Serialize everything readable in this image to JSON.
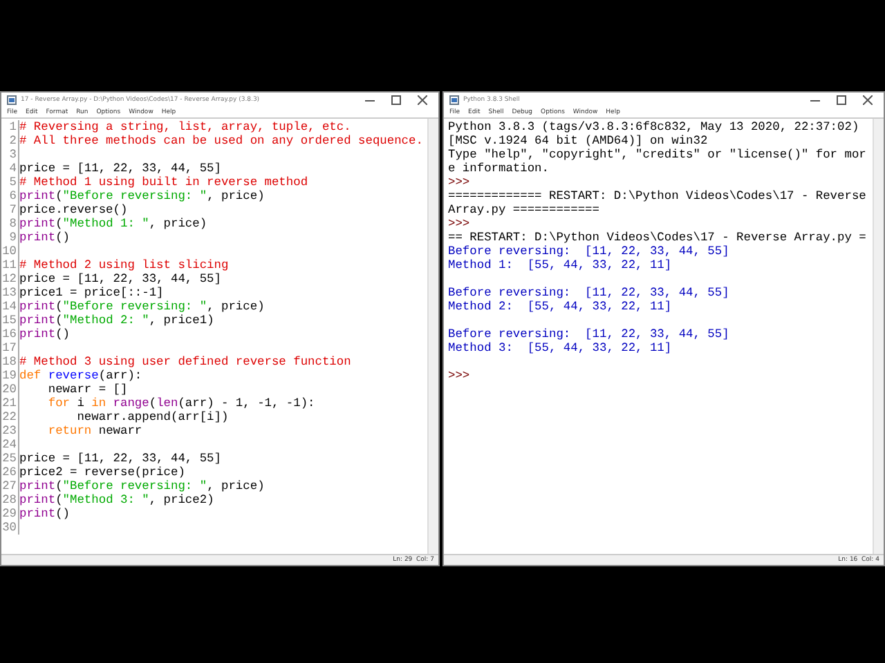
{
  "editor": {
    "title": "17 - Reverse Array.py - D:\\Python Videos\\Codes\\17 - Reverse Array.py (3.8.3)",
    "menu": [
      "File",
      "Edit",
      "Format",
      "Run",
      "Options",
      "Window",
      "Help"
    ],
    "lines": [
      {
        "number": "1",
        "tokens": [
          {
            "kind": "comment",
            "text": "# Reversing a string, list, array, tuple, etc."
          }
        ]
      },
      {
        "number": "2",
        "tokens": [
          {
            "kind": "comment",
            "text": "# All three methods can be used on any ordered sequence."
          }
        ]
      },
      {
        "number": "3"
      },
      {
        "number": "4",
        "tokens": [
          {
            "kind": "plain",
            "text": "price = [11, 22, 33, 44, 55]"
          }
        ]
      },
      {
        "number": "5",
        "tokens": [
          {
            "kind": "comment",
            "text": "# Method 1 using built in reverse method"
          }
        ]
      },
      {
        "number": "6",
        "tokens": [
          {
            "kind": "builtin",
            "text": "print"
          },
          {
            "kind": "plain",
            "text": "("
          },
          {
            "kind": "string",
            "text": "\"Before reversing: \""
          },
          {
            "kind": "plain",
            "text": ", price)"
          }
        ]
      },
      {
        "number": "7",
        "tokens": [
          {
            "kind": "plain",
            "text": "price.reverse()"
          }
        ]
      },
      {
        "number": "8",
        "tokens": [
          {
            "kind": "builtin",
            "text": "print"
          },
          {
            "kind": "plain",
            "text": "("
          },
          {
            "kind": "string",
            "text": "\"Method 1: \""
          },
          {
            "kind": "plain",
            "text": ", price)"
          }
        ]
      },
      {
        "number": "9",
        "tokens": [
          {
            "kind": "builtin",
            "text": "print"
          },
          {
            "kind": "plain",
            "text": "()"
          }
        ]
      },
      {
        "number": "10"
      },
      {
        "number": "11",
        "tokens": [
          {
            "kind": "comment",
            "text": "# Method 2 using list slicing"
          }
        ]
      },
      {
        "number": "12",
        "tokens": [
          {
            "kind": "plain",
            "text": "price = [11, 22, 33, 44, 55]"
          }
        ]
      },
      {
        "number": "13",
        "tokens": [
          {
            "kind": "plain",
            "text": "price1 = price[::-1]"
          }
        ]
      },
      {
        "number": "14",
        "tokens": [
          {
            "kind": "builtin",
            "text": "print"
          },
          {
            "kind": "plain",
            "text": "("
          },
          {
            "kind": "string",
            "text": "\"Before reversing: \""
          },
          {
            "kind": "plain",
            "text": ", price)"
          }
        ]
      },
      {
        "number": "15",
        "tokens": [
          {
            "kind": "builtin",
            "text": "print"
          },
          {
            "kind": "plain",
            "text": "("
          },
          {
            "kind": "string",
            "text": "\"Method 2: \""
          },
          {
            "kind": "plain",
            "text": ", price1)"
          }
        ]
      },
      {
        "number": "16",
        "tokens": [
          {
            "kind": "builtin",
            "text": "print"
          },
          {
            "kind": "plain",
            "text": "()"
          }
        ]
      },
      {
        "number": "17"
      },
      {
        "number": "18",
        "tokens": [
          {
            "kind": "comment",
            "text": "# Method 3 using user defined reverse function"
          }
        ]
      },
      {
        "number": "19",
        "tokens": [
          {
            "kind": "keyword",
            "text": "def"
          },
          {
            "kind": "definition",
            "text": " reverse"
          },
          {
            "kind": "plain",
            "text": "(arr):"
          }
        ]
      },
      {
        "number": "20",
        "tokens": [
          {
            "kind": "plain",
            "text": "    newarr = []"
          }
        ]
      },
      {
        "number": "21",
        "tokens": [
          {
            "kind": "keyword",
            "text": "    for"
          },
          {
            "kind": "plain",
            "text": " i "
          },
          {
            "kind": "keyword",
            "text": "in"
          },
          {
            "kind": "builtin",
            "text": " range"
          },
          {
            "kind": "plain",
            "text": "("
          },
          {
            "kind": "builtin",
            "text": "len"
          },
          {
            "kind": "plain",
            "text": "(arr) - 1, -1, -1):"
          }
        ]
      },
      {
        "number": "22",
        "tokens": [
          {
            "kind": "plain",
            "text": "        newarr.append(arr[i])"
          }
        ]
      },
      {
        "number": "23",
        "tokens": [
          {
            "kind": "keyword",
            "text": "    return"
          },
          {
            "kind": "plain",
            "text": " newarr"
          }
        ]
      },
      {
        "number": "24"
      },
      {
        "number": "25",
        "tokens": [
          {
            "kind": "plain",
            "text": "price = [11, 22, 33, 44, 55]"
          }
        ]
      },
      {
        "number": "26",
        "tokens": [
          {
            "kind": "plain",
            "text": "price2 = reverse(price)"
          }
        ]
      },
      {
        "number": "27",
        "tokens": [
          {
            "kind": "builtin",
            "text": "print"
          },
          {
            "kind": "plain",
            "text": "("
          },
          {
            "kind": "string",
            "text": "\"Before reversing: \""
          },
          {
            "kind": "plain",
            "text": ", price)"
          }
        ]
      },
      {
        "number": "28",
        "tokens": [
          {
            "kind": "builtin",
            "text": "print"
          },
          {
            "kind": "plain",
            "text": "("
          },
          {
            "kind": "string",
            "text": "\"Method 3: \""
          },
          {
            "kind": "plain",
            "text": ", price2)"
          }
        ]
      },
      {
        "number": "29",
        "tokens": [
          {
            "kind": "builtin",
            "text": "print"
          },
          {
            "kind": "plain",
            "text": "()"
          }
        ]
      },
      {
        "number": "30"
      }
    ],
    "status": "Ln: 29  Col: 7"
  },
  "shell": {
    "title": "Python 3.8.3 Shell",
    "menu": [
      "File",
      "Edit",
      "Shell",
      "Debug",
      "Options",
      "Window",
      "Help"
    ],
    "blocks": [
      {
        "lines": [
          {
            "kind": "info",
            "text": "Python 3.8.3 (tags/v3.8.3:6f8c832, May 13 2020, 22:37:02)"
          },
          {
            "kind": "info",
            "text": "[MSC v.1924 64 bit (AMD64)] on win32"
          },
          {
            "kind": "info",
            "text": "Type \"help\", \"copyright\", \"credits\" or \"license()\" for mor"
          },
          {
            "kind": "info",
            "text": "e information."
          },
          {
            "kind": "prompt",
            "text": ">>>"
          },
          {
            "kind": "info",
            "text": "============= RESTART: D:\\Python Videos\\Codes\\17 - Reverse"
          },
          {
            "kind": "info",
            "text": "Array.py ============"
          },
          {
            "kind": "prompt",
            "text": ">>>"
          },
          {
            "kind": "info",
            "text": "== RESTART: D:\\Python Videos\\Codes\\17 - Reverse Array.py ="
          },
          {
            "kind": "output",
            "text": "Before reversing:  [11, 22, 33, 44, 55]"
          },
          {
            "kind": "output",
            "text": "Method 1:  [55, 44, 33, 22, 11]"
          }
        ]
      },
      {
        "lines": [
          {
            "kind": "output",
            "text": "Before reversing:  [11, 22, 33, 44, 55]"
          },
          {
            "kind": "output",
            "text": "Method 2:  [55, 44, 33, 22, 11]"
          }
        ]
      },
      {
        "lines": [
          {
            "kind": "output",
            "text": "Before reversing:  [11, 22, 33, 44, 55]"
          },
          {
            "kind": "output",
            "text": "Method 3:  [55, 44, 33, 22, 11]"
          }
        ]
      },
      {
        "lines": [
          {
            "kind": "prompt",
            "text": ">>>"
          }
        ]
      }
    ],
    "status": "Ln: 16  Col: 4"
  }
}
